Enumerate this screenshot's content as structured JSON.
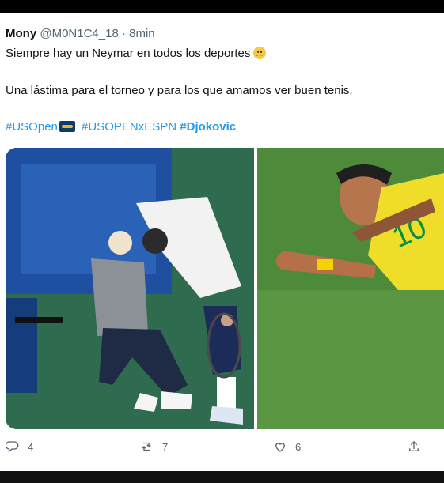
{
  "tweet": {
    "name": "Mony",
    "handle": "@M0N1C4_18",
    "separator": "·",
    "time": "8min",
    "line1": "Siempre hay un Neymar en todos los deportes",
    "line2": "Una lástima para el torneo y para los que amamos ver buen tenis.",
    "hashtags": [
      "#USOpen",
      "#USOPENxESPN",
      "#Djokovic"
    ]
  },
  "actions": {
    "replies": "4",
    "retweets": "7",
    "likes": "6"
  },
  "colors": {
    "link": "#1d9bf0",
    "muted": "#536471"
  },
  "icons": {
    "emoji": "frowning-face-emoji",
    "flag": "usopen-flag-emoji",
    "reply": "reply-icon",
    "retweet": "retweet-icon",
    "like": "heart-icon",
    "share": "share-icon"
  }
}
